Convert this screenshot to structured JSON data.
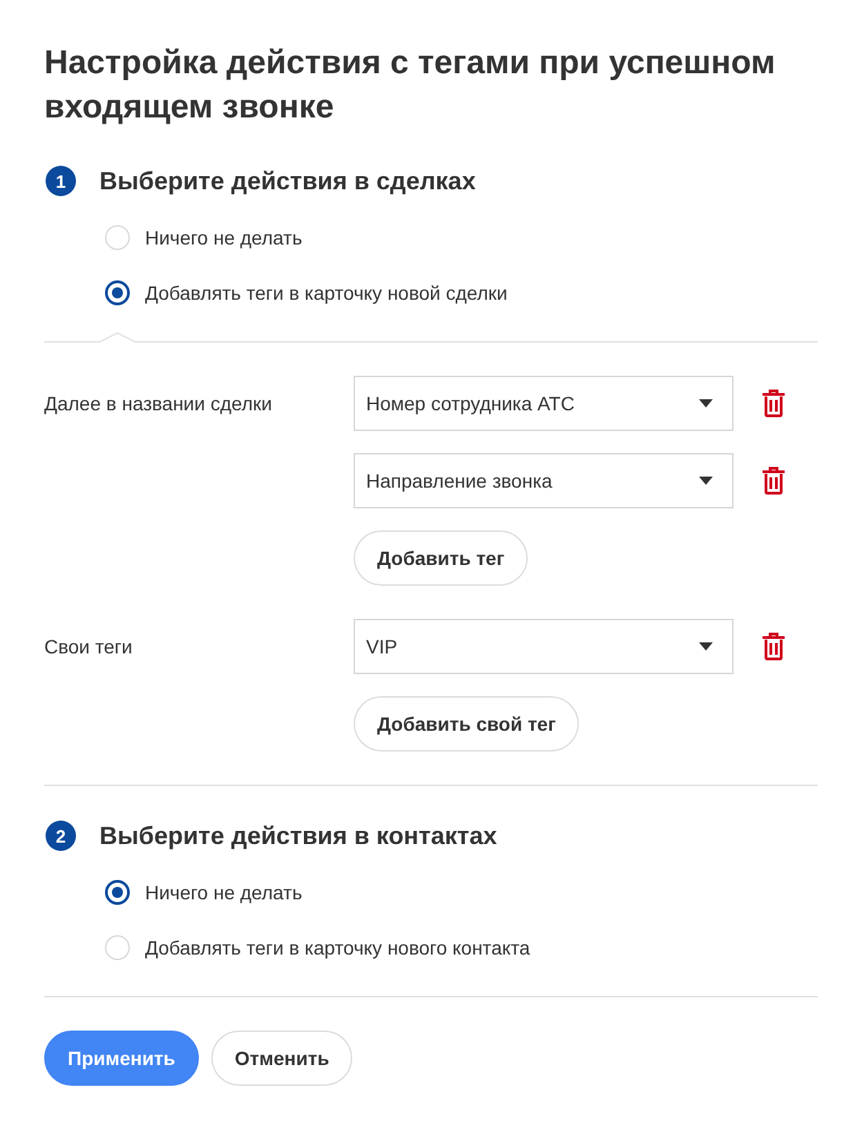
{
  "title": "Настройка действия с тегами при успешном входящем звонке",
  "sections": [
    {
      "number": "1",
      "heading": "Выберите действия в сделках",
      "options": [
        {
          "label": "Ничего не делать",
          "selected": false
        },
        {
          "label": "Добавлять теги в карточку новой сделки",
          "selected": true
        }
      ],
      "tag_panel": {
        "groups": [
          {
            "label": "Далее в названии сделки",
            "selects": [
              {
                "value": "Номер сотрудника АТС"
              },
              {
                "value": "Направление звонка"
              }
            ],
            "add_button": "Добавить тег"
          },
          {
            "label": "Свои теги",
            "selects": [
              {
                "value": "VIP"
              }
            ],
            "add_button": "Добавить свой тег"
          }
        ]
      }
    },
    {
      "number": "2",
      "heading": "Выберите действия в контактах",
      "options": [
        {
          "label": "Ничего не делать",
          "selected": true
        },
        {
          "label": "Добавлять теги в карточку нового контакта",
          "selected": false
        }
      ]
    }
  ],
  "buttons": [
    {
      "label": "Применить",
      "kind": "primary"
    },
    {
      "label": "Отменить",
      "kind": "secondary"
    }
  ]
}
